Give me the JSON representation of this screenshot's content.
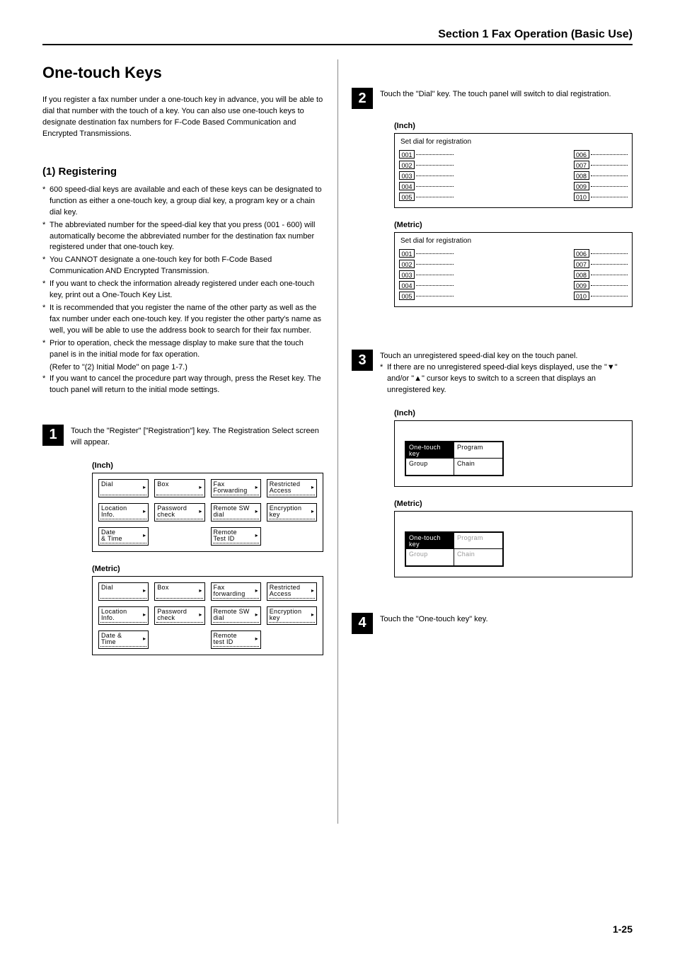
{
  "header": "Section 1  Fax Operation (Basic Use)",
  "title": "One-touch Keys",
  "intro": "If you register a fax number under a one-touch key in advance, you will be able to dial that number with the touch of a key. You can also use one-touch keys to designate destination fax numbers for F-Code Based Communication and Encrypted Transmissions.",
  "sub1": "(1) Registering",
  "bullets": [
    "600 speed-dial keys are available and each of these keys can be designated to function as either a one-touch key, a group dial key, a program key or a chain dial key.",
    "The abbreviated number for the speed-dial key that you press (001 - 600) will automatically become the abbreviated number for the destination fax number registered under that one-touch key.",
    "You CANNOT designate a one-touch key for both F-Code Based Communication AND Encrypted Transmission.",
    "If you want to check the information already registered under each one-touch key, print out a One-Touch Key List.",
    "It is recommended that you register the name of the other party as well as the fax number under each one-touch key. If you register the other party's name as well, you will be able to use the address book to search for their fax number.",
    "Prior to operation, check the message display to make sure that the touch panel is in the initial mode for fax operation.",
    "If you want to cancel the procedure part way through, press the Reset key. The touch panel will return to the initial mode settings."
  ],
  "bullet5_sub": "(Refer to \"(2) Initial Mode\" on page 1-7.)",
  "steps": {
    "1": "Touch the \"Register\" [\"Registration\"] key. The Registration Select screen will appear.",
    "2": "Touch the \"Dial\" key. The touch panel will switch to dial registration.",
    "3": "Touch an unregistered speed-dial key on the touch panel.",
    "3sub": "If there are no unregistered speed-dial keys displayed, use the \"▼\" and/or \"▲\" cursor keys to switch to a screen that displays an unregistered key.",
    "4": "Touch the \"One-touch key\" key."
  },
  "labels": {
    "inch": "(Inch)",
    "metric": "(Metric)"
  },
  "fig1_inch": [
    [
      "Dial",
      "Box",
      "Fax\nForwarding",
      "Restricted\nAccess"
    ],
    [
      "Location\nInfo.",
      "Password\ncheck",
      "Remote SW\ndial",
      "Encryption\nkey"
    ],
    [
      "Date\n& Time",
      "",
      "Remote\nTest ID",
      ""
    ]
  ],
  "fig1_metric": [
    [
      "Dial",
      "Box",
      "Fax\nforwarding",
      "Restricted\nAccess"
    ],
    [
      "Location\nInfo.",
      "Password\ncheck",
      "Remote SW\ndial",
      "Encryption\nkey"
    ],
    [
      "Date &\nTime",
      "",
      "Remote\ntest ID",
      ""
    ]
  ],
  "fig2_title": "Set dial for registration",
  "fig2_left": [
    "001",
    "002",
    "003",
    "004",
    "005"
  ],
  "fig2_right": [
    "006",
    "007",
    "008",
    "009",
    "010"
  ],
  "fig3": {
    "a": "One-touch\nkey",
    "b": "Program",
    "c": "Group",
    "d": "Chain"
  },
  "page": "1-25"
}
